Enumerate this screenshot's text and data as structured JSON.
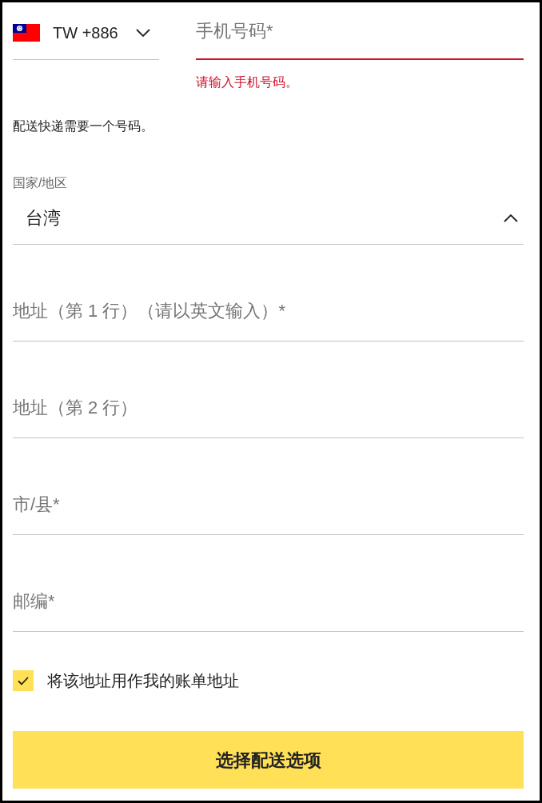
{
  "phone": {
    "country_code": "TW +886",
    "country_code_expanded": false,
    "placeholder": "手机号码*",
    "invalid": true,
    "error": "请输入手机号码。"
  },
  "phone_note": "配送快递需要一个号码。",
  "country": {
    "label": "国家/地区",
    "value": "台湾",
    "expanded": true
  },
  "address_fields": [
    {
      "placeholder": "地址（第 1 行）（请以英文输入）*"
    },
    {
      "placeholder": "地址（第 2 行）"
    },
    {
      "placeholder": "市/县*"
    },
    {
      "placeholder": "邮编*"
    }
  ],
  "billing_checkbox": {
    "label": "将该地址用作我的账单地址",
    "checked": true
  },
  "submit_button": {
    "label": "选择配送选项"
  }
}
